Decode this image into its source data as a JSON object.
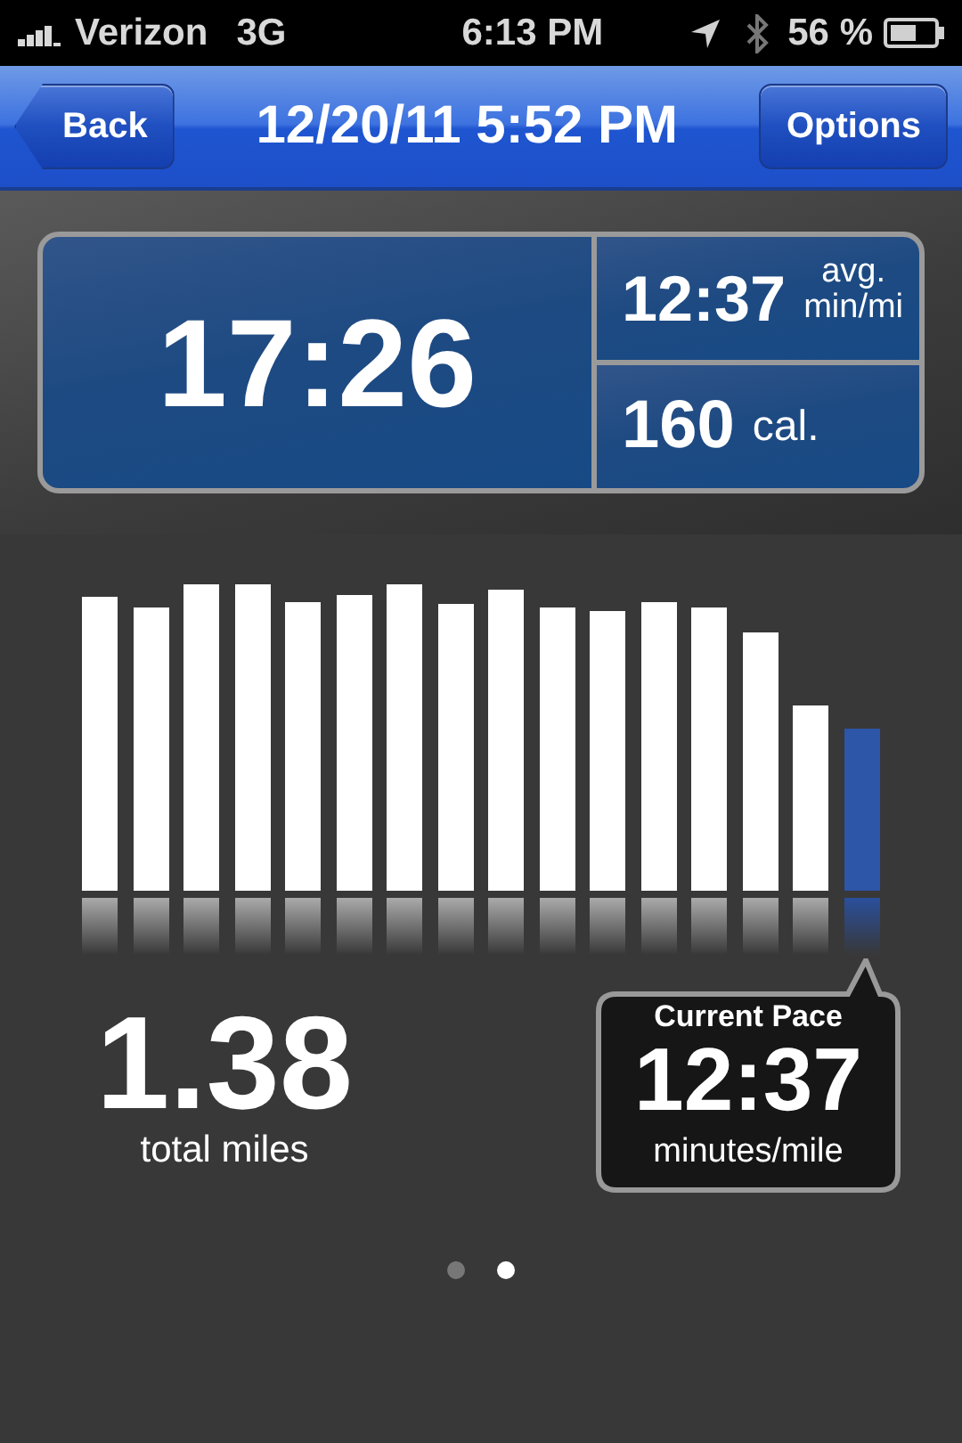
{
  "status_bar": {
    "carrier": "Verizon",
    "network": "3G",
    "time": "6:13 PM",
    "battery": "56 %"
  },
  "nav": {
    "back": "Back",
    "title": "12/20/11 5:52 PM",
    "options": "Options"
  },
  "stats": {
    "duration": "17:26",
    "pace": "12:37",
    "pace_unit_1": "avg.",
    "pace_unit_2": "min/mi",
    "calories": "160",
    "calories_unit": "cal."
  },
  "bars": [
    {
      "selected": false
    },
    {
      "selected": false
    },
    {
      "selected": false
    },
    {
      "selected": false
    },
    {
      "selected": false
    },
    {
      "selected": false
    },
    {
      "selected": false
    },
    {
      "selected": false
    },
    {
      "selected": false
    },
    {
      "selected": false
    },
    {
      "selected": false
    },
    {
      "selected": false
    },
    {
      "selected": false
    },
    {
      "selected": false
    },
    {
      "selected": false
    },
    {
      "selected": true
    }
  ],
  "distance": {
    "value": "1.38",
    "label": "total miles"
  },
  "current_pace": {
    "title": "Current Pace",
    "value": "12:37",
    "unit": "minutes/mile"
  },
  "pages": [
    {
      "selected": false
    },
    {
      "selected": true
    }
  ]
}
